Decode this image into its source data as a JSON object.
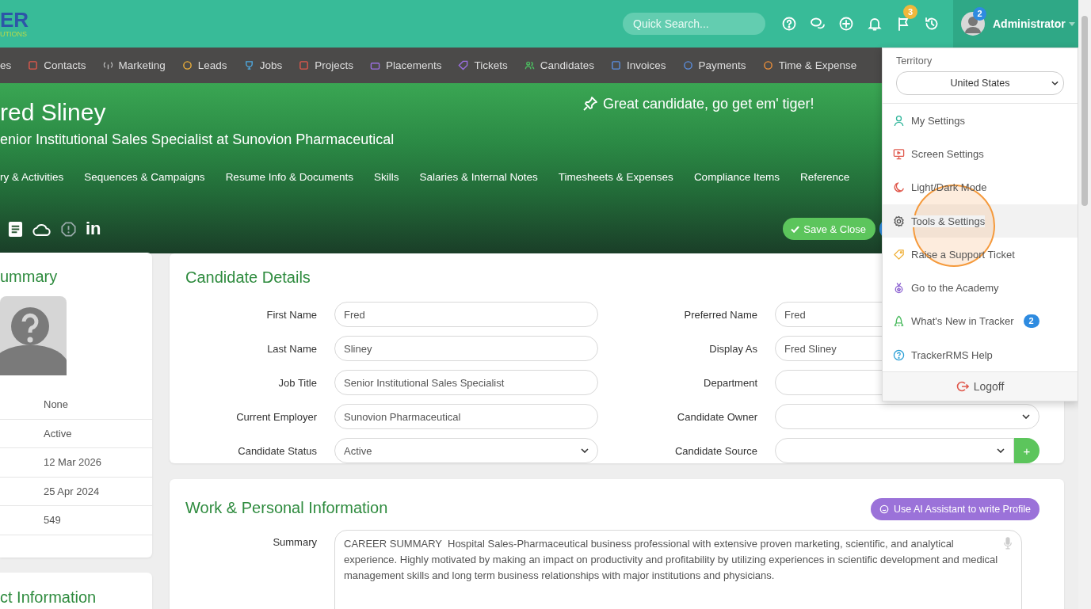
{
  "logo": {
    "text": "ER",
    "tagline": "UTIONS"
  },
  "header": {
    "search": {
      "placeholder": "Quick Search..."
    },
    "icons": [
      {
        "kind": "help"
      },
      {
        "kind": "chat"
      },
      {
        "kind": "add"
      },
      {
        "kind": "bell"
      },
      {
        "kind": "flag",
        "badge": "3"
      },
      {
        "kind": "history"
      }
    ],
    "user": {
      "name": "Administrator",
      "badge": "2"
    }
  },
  "nav": [
    {
      "label": "es",
      "kind": "none"
    },
    {
      "label": "Contacts",
      "kind": "contacts"
    },
    {
      "label": "Marketing",
      "kind": "marketing"
    },
    {
      "label": "Leads",
      "kind": "leads"
    },
    {
      "label": "Jobs",
      "kind": "jobs"
    },
    {
      "label": "Projects",
      "kind": "projects"
    },
    {
      "label": "Placements",
      "kind": "placements"
    },
    {
      "label": "Tickets",
      "kind": "tickets"
    },
    {
      "label": "Candidates",
      "kind": "candidates"
    },
    {
      "label": "Invoices",
      "kind": "invoices"
    },
    {
      "label": "Payments",
      "kind": "payments"
    },
    {
      "label": "Time & Expense",
      "kind": "time"
    }
  ],
  "hero": {
    "name": "red Sliney",
    "subtitle": "enior Institutional Sales Specialist at Sunovion Pharmaceutical",
    "tagline": "Great candidate, go get em' tiger!",
    "tabs": [
      "ry & Activities",
      "Sequences & Campaigns",
      "Resume Info & Documents",
      "Skills",
      "Salaries & Internal Notes",
      "Timesheets & Expenses",
      "Compliance Items",
      "Reference"
    ],
    "actions": [
      {
        "kind": "document"
      },
      {
        "kind": "cloud"
      },
      {
        "kind": "warning"
      },
      {
        "kind": "linkedin",
        "text": "in"
      }
    ],
    "save_button": "Save & Close"
  },
  "summary_card": {
    "title": "ummary",
    "values": [
      "None",
      "Active",
      "12 Mar 2026",
      "25 Apr 2024",
      "549"
    ]
  },
  "contact_card": {
    "title": "ct Information"
  },
  "candidate_details": {
    "title": "Candidate Details",
    "left": [
      {
        "label": "First Name",
        "value": "Fred",
        "kind": "text"
      },
      {
        "label": "Last Name",
        "value": "Sliney",
        "kind": "text"
      },
      {
        "label": "Job Title",
        "value": "Senior Institutional Sales Specialist",
        "kind": "text"
      },
      {
        "label": "Current Employer",
        "value": "Sunovion Pharmaceutical",
        "kind": "text"
      },
      {
        "label": "Candidate Status",
        "value": "Active",
        "kind": "select"
      }
    ],
    "right": [
      {
        "label": "Preferred Name",
        "value": "Fred",
        "kind": "text"
      },
      {
        "label": "Display As",
        "value": "Fred Sliney",
        "kind": "text"
      },
      {
        "label": "Department",
        "kind": "text"
      },
      {
        "label": "Candidate Owner",
        "kind": "select"
      },
      {
        "label": "Candidate Source",
        "kind": "select",
        "add_button": "+"
      }
    ]
  },
  "work_info": {
    "title": "Work & Personal Information",
    "ai_button": "Use AI Assistant to write Profile",
    "summary_label": "Summary",
    "summary": "CAREER SUMMARY  Hospital Sales-Pharmaceutical business professional with extensive proven marketing, scientific, and analytical experience. Highly motivated by making an impact on productivity and profitability by utilizing experiences in scientific development and medical management skills and long term business relationships with major institutions and physicians."
  },
  "user_menu": {
    "territory_label": "Territory",
    "territory": "United States",
    "items": [
      {
        "label": "My Settings",
        "kind": "person",
        "selected": false
      },
      {
        "label": "Screen Settings",
        "kind": "screen",
        "selected": false
      },
      {
        "label": "Light/Dark Mode",
        "kind": "moon",
        "selected": false
      },
      {
        "label": "Tools & Settings",
        "kind": "gear",
        "selected": true
      },
      {
        "label": "Raise a Support Ticket",
        "kind": "tag",
        "selected": false
      },
      {
        "label": "Go to the Academy",
        "kind": "medal",
        "selected": false
      },
      {
        "label": "What's New in Tracker",
        "kind": "rocket",
        "selected": false,
        "badge": "2"
      },
      {
        "label": "TrackerRMS Help",
        "kind": "help",
        "selected": false
      }
    ],
    "logoff": "Logoff"
  }
}
